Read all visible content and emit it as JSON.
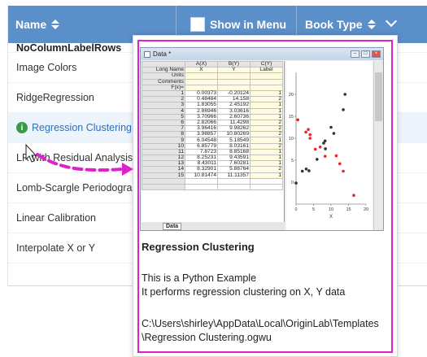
{
  "table": {
    "headers": {
      "name": "Name",
      "show_in_menu": "Show in Menu",
      "book_type": "Book Type"
    },
    "rows": [
      {
        "label": "NoColumnLabelRows"
      },
      {
        "label": "Image Colors"
      },
      {
        "label": "RidgeRegression"
      },
      {
        "label": "Regression Clustering"
      },
      {
        "label": "LR with Residual Analysis"
      },
      {
        "label": "Lomb-Scargle Periodogram"
      },
      {
        "label": "Linear Calibration"
      },
      {
        "label": "Interpolate X or Y"
      }
    ]
  },
  "tooltip": {
    "title": "Regression Clustering",
    "desc_line1": "This is a Python Example",
    "desc_line2": "It performs regression clustering on X, Y data",
    "path": "C:\\Users\\shirley\\AppData\\Local\\OriginLab\\Templates\\Regression Clustering.ogwu"
  },
  "preview": {
    "window_title": "Data *",
    "sheet_tab": "Data",
    "columns": [
      "A(X)",
      "B(Y)",
      "C(Y)"
    ],
    "meta_rows": [
      {
        "name": "Long Name",
        "a": "X",
        "b": "Y",
        "c": "Label"
      },
      {
        "name": "Units",
        "a": "",
        "b": "",
        "c": ""
      },
      {
        "name": "Comments",
        "a": "",
        "b": "",
        "c": ""
      },
      {
        "name": "F(x)=",
        "a": "",
        "b": "",
        "c": ""
      }
    ],
    "data_rows": [
      [
        "1",
        "0.00373",
        "-0.20124",
        "1"
      ],
      [
        "2",
        "0.48484",
        "14.158",
        "2"
      ],
      [
        "3",
        "1.83055",
        "2.45192",
        "1"
      ],
      [
        "4",
        "2.86946",
        "3.03616",
        "1"
      ],
      [
        "5",
        "3.70966",
        "2.60736",
        "1"
      ],
      [
        "6",
        "2.82066",
        "11.4298",
        "2"
      ],
      [
        "7",
        "3.96416",
        "9.98262",
        "2"
      ],
      [
        "8",
        "3.98857",
        "10.80269",
        "2"
      ],
      [
        "9",
        "6.04548",
        "5.18549",
        "1"
      ],
      [
        "10",
        "6.85779",
        "8.03161",
        "2"
      ],
      [
        "11",
        "7.8723",
        "8.85168",
        "1"
      ],
      [
        "12",
        "8.25231",
        "9.43591",
        "1"
      ],
      [
        "13",
        "8.43011",
        "7.60281",
        "1"
      ],
      [
        "14",
        "8.32901",
        "5.88764",
        "2"
      ],
      [
        "15",
        "10.81474",
        "11.11357",
        "1"
      ]
    ],
    "chart_data": {
      "type": "scatter",
      "xlabel": "X",
      "ylabel": "",
      "xlim": [
        0,
        20
      ],
      "ylim": [
        -5,
        25
      ],
      "xticks": [
        "0",
        "5",
        "10",
        "15",
        "20"
      ],
      "yticks": [
        "0",
        "5",
        "10",
        "15",
        "20"
      ],
      "series": [
        {
          "color": "#e8262a",
          "points": [
            [
              0.5,
              14.2
            ],
            [
              2.8,
              11.4
            ],
            [
              4.0,
              10.0
            ],
            [
              4.0,
              10.8
            ],
            [
              6.9,
              8.0
            ],
            [
              8.3,
              5.9
            ],
            [
              11.5,
              6.0
            ],
            [
              12.5,
              4.2
            ],
            [
              13.5,
              2.5
            ],
            [
              16.5,
              -3.0
            ],
            [
              5.5,
              7.5
            ],
            [
              3.5,
              12.0
            ]
          ]
        },
        {
          "color": "#333333",
          "points": [
            [
              0.0,
              -0.2
            ],
            [
              1.8,
              2.5
            ],
            [
              2.9,
              3.0
            ],
            [
              3.7,
              2.6
            ],
            [
              6.0,
              5.2
            ],
            [
              7.9,
              8.9
            ],
            [
              8.3,
              9.4
            ],
            [
              8.4,
              7.6
            ],
            [
              10.8,
              11.1
            ],
            [
              13.5,
              16.5
            ],
            [
              14.0,
              20.0
            ],
            [
              10.0,
              12.5
            ]
          ]
        }
      ]
    }
  },
  "colors": {
    "header": "#5b8fc9",
    "accent": "#dd22cc",
    "link": "#2f6fb5"
  }
}
